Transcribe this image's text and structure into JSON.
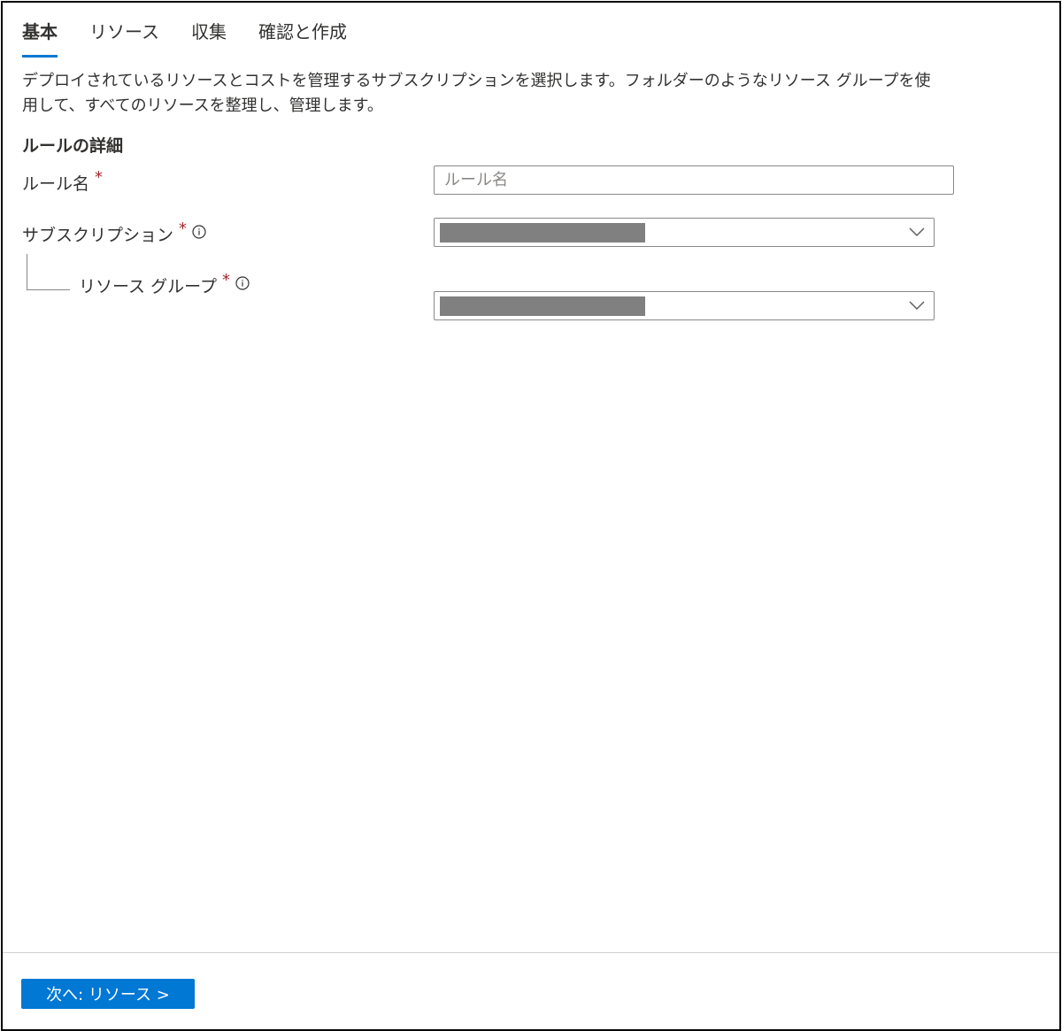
{
  "tabs": [
    {
      "label": "基本",
      "active": true
    },
    {
      "label": "リソース",
      "active": false
    },
    {
      "label": "収集",
      "active": false
    },
    {
      "label": "確認と作成",
      "active": false
    }
  ],
  "description": "デプロイされているリソースとコストを管理するサブスクリプションを選択します。フォルダーのようなリソース グループを使用して、すべてのリソースを整理し、管理します。",
  "section_title": "ルールの詳細",
  "form": {
    "rule_name": {
      "label": "ルール名",
      "required_mark": "*",
      "value": "",
      "placeholder": "ルール名"
    },
    "subscription": {
      "label": "サブスクリプション",
      "required_mark": "*",
      "icon": "info-icon",
      "value_redacted": true
    },
    "resource_group": {
      "label": "リソース グループ",
      "required_mark": "*",
      "icon": "info-icon",
      "value_redacted": true
    }
  },
  "footer": {
    "next_button_label": "次へ: リソース >"
  },
  "colors": {
    "accent": "#0078d4",
    "required": "#a4262c",
    "border": "#8a8886",
    "redacted": "#808080"
  }
}
